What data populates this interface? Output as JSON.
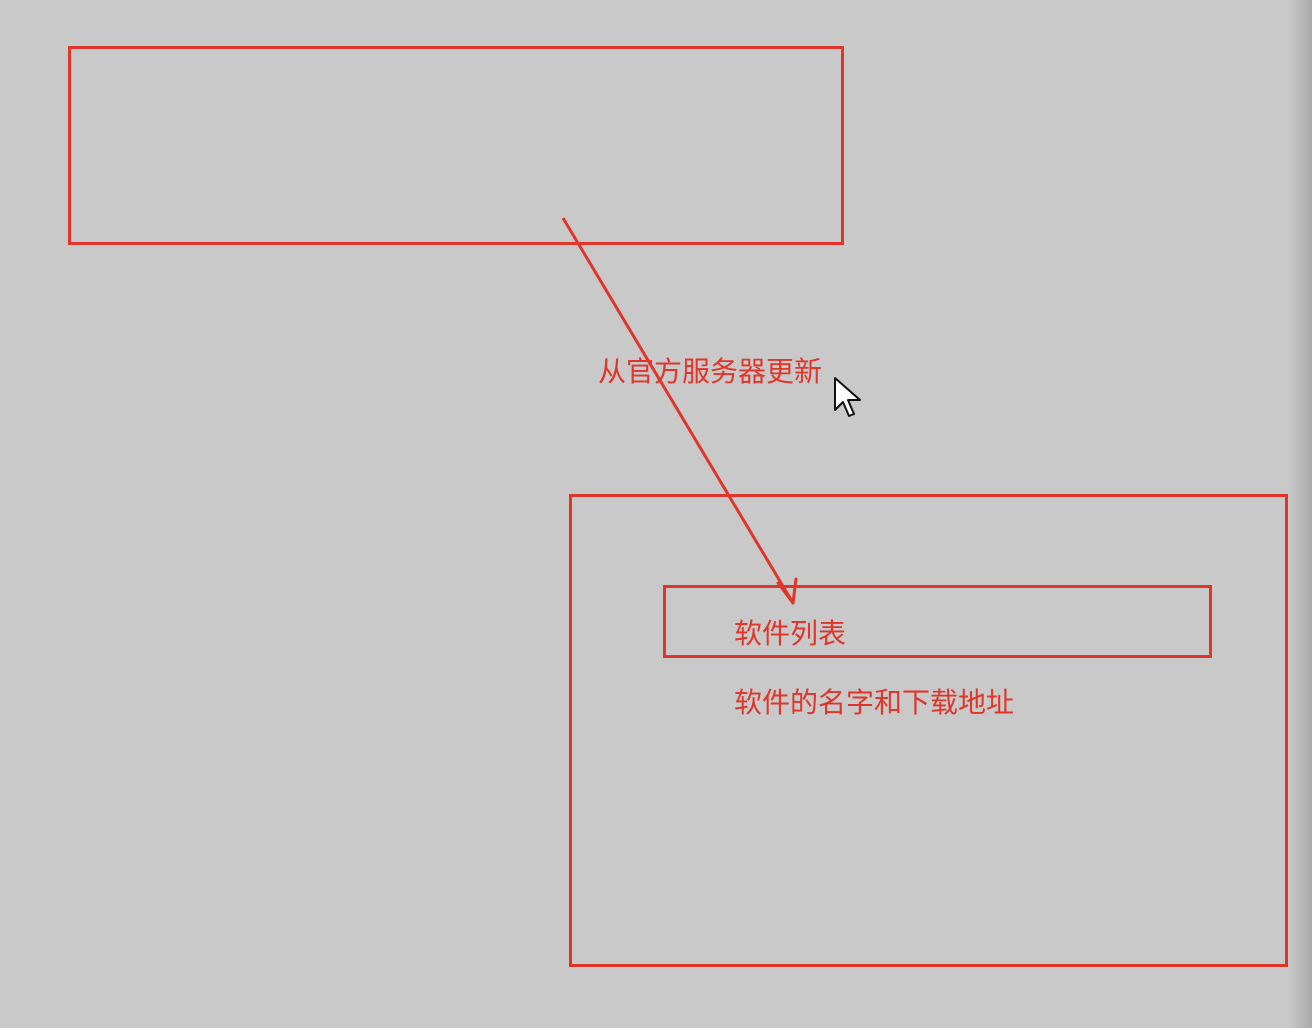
{
  "diagram": {
    "arrow_label": "从官方服务器更新",
    "list_box_label": "软件列表",
    "list_box_description": "软件的名字和下载地址"
  },
  "colors": {
    "background": "#c9c9c9",
    "stroke": "#e0352b",
    "text": "#e0352b"
  },
  "icons": {
    "cursor": "mouse-pointer-icon"
  }
}
